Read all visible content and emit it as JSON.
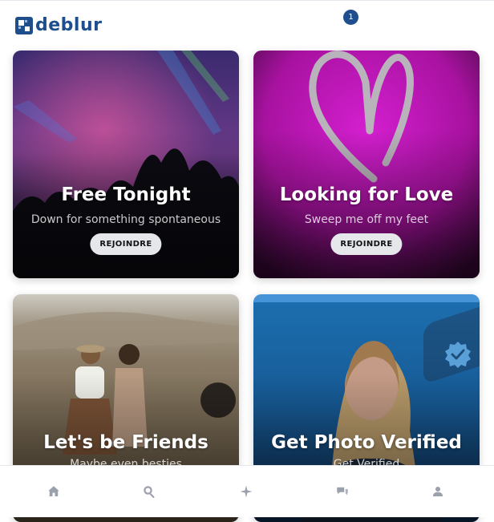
{
  "app": {
    "logo_text": "deblur",
    "brand_color": "#1f4e8c"
  },
  "cards": [
    {
      "title": "Free Tonight",
      "subtitle": "Down for something spontaneous",
      "button": "REJOINDRE"
    },
    {
      "title": "Looking for Love",
      "subtitle": "Sweep me off my feet",
      "button": "REJOINDRE"
    },
    {
      "title": "Let's be Friends",
      "subtitle": "Maybe even besties"
    },
    {
      "title": "Get Photo Verified",
      "subtitle": "Get Verified"
    }
  ],
  "nav": {
    "items": [
      "home-icon",
      "search-icon",
      "sparkle-icon",
      "chat-icon",
      "profile-icon"
    ],
    "chat_badge": "1"
  }
}
